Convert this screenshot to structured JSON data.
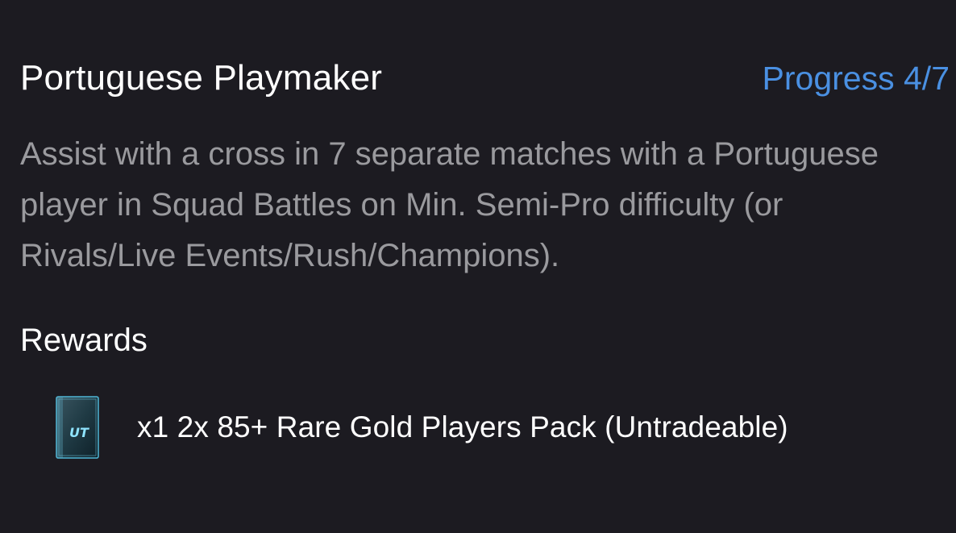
{
  "objective": {
    "title": "Portuguese Playmaker",
    "progress": "Progress 4/7",
    "description": "Assist with a cross in 7 separate matches with a Portuguese player in Squad Battles on Min. Semi-Pro difficulty (or Rivals/Live Events/Rush/Champions).",
    "accent_color": "#4a90e2"
  },
  "rewards": {
    "heading": "Rewards",
    "items": [
      {
        "icon": "ut-pack-icon",
        "icon_label": "UT",
        "label": "x1 2x 85+ Rare Gold Players Pack (Untradeable)"
      }
    ]
  }
}
